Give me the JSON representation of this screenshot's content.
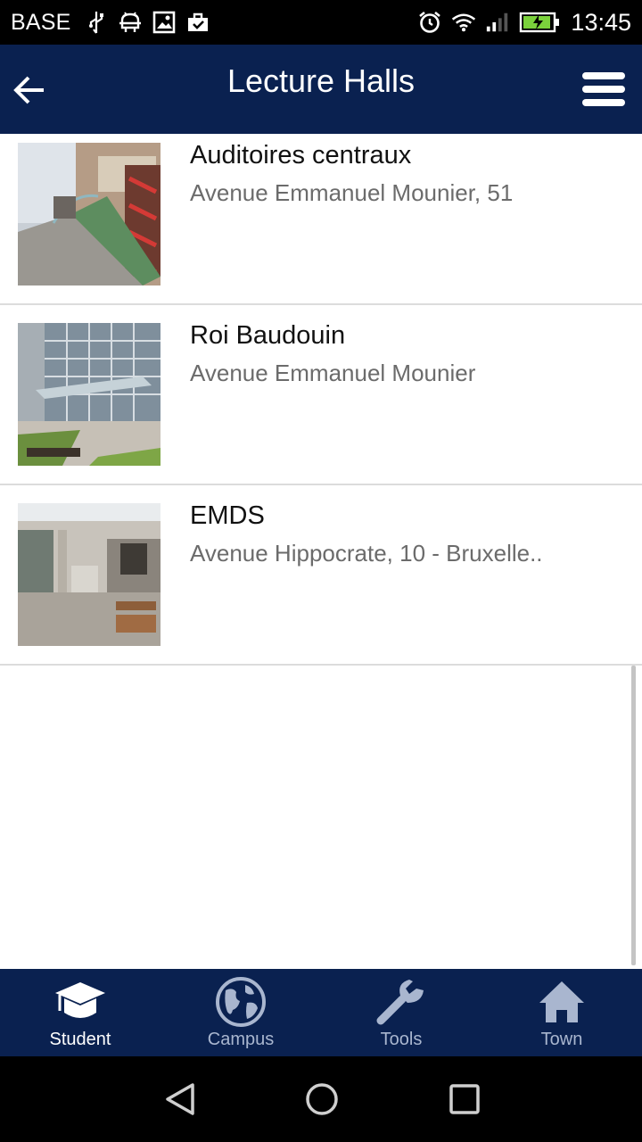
{
  "status_bar": {
    "carrier": "BASE",
    "time": "13:45",
    "left_icons": [
      "usb-icon",
      "android-debug-icon",
      "image-icon",
      "briefcase-check-icon"
    ],
    "right_icons": [
      "alarm-icon",
      "wifi-icon",
      "signal-icon",
      "battery-charging-icon"
    ]
  },
  "app_bar": {
    "title": "Lecture Halls",
    "background": "#0a2150"
  },
  "halls": [
    {
      "name": "Auditoires centraux",
      "address": "Avenue Emmanuel Mounier, 51"
    },
    {
      "name": "Roi Baudouin",
      "address": "Avenue Emmanuel Mounier"
    },
    {
      "name": "EMDS",
      "address": "Avenue Hippocrate, 10 - Bruxelle.."
    }
  ],
  "bottom_nav": {
    "tabs": [
      {
        "label": "Student",
        "icon": "graduation-cap-icon",
        "active": true
      },
      {
        "label": "Campus",
        "icon": "globe-icon",
        "active": false
      },
      {
        "label": "Tools",
        "icon": "wrench-icon",
        "active": false
      },
      {
        "label": "Town",
        "icon": "home-icon",
        "active": false
      }
    ]
  },
  "system_nav": [
    "back-icon",
    "home-circle-icon",
    "recents-icon"
  ],
  "colors": {
    "accent": "#0a2150",
    "active_label": "#ffffff",
    "inactive": "#a9b6cf"
  }
}
